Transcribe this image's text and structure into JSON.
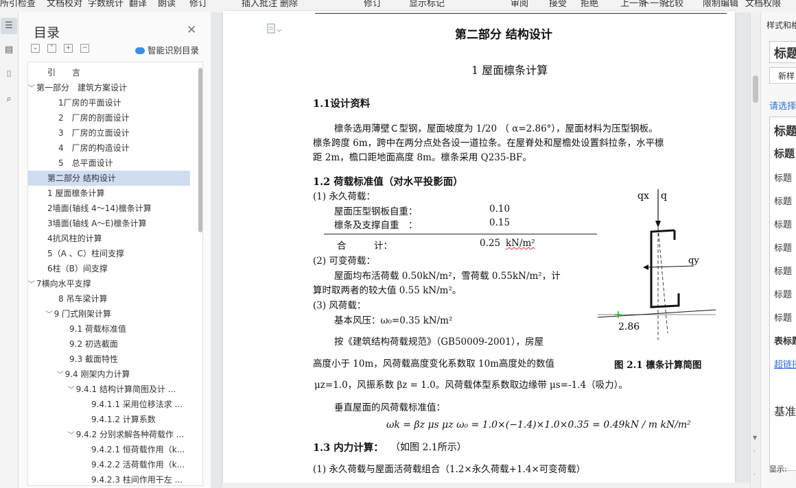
{
  "toolbar": {
    "items": [
      "所引检查",
      "文档校对",
      "字数统计",
      "翻译",
      "朗读",
      "修订",
      "插入批注",
      "删除",
      "修订",
      "显示标记",
      "审阅",
      "接受",
      "拒绝",
      "上一条",
      "下一条",
      "比较",
      "限制编辑",
      "文档权限"
    ]
  },
  "rail": {
    "icons": [
      "toc-icon",
      "outline-icon",
      "bookmark-icon",
      "search-icon"
    ]
  },
  "toc": {
    "title": "目录",
    "smart_label": "智能识别目录",
    "items": [
      {
        "label": "引　　言",
        "level": 1,
        "caret": ""
      },
      {
        "label": "第一部分　建筑方案设计",
        "level": 0,
        "caret": "﹀"
      },
      {
        "label": "1厂房的平面设计",
        "level": 2,
        "caret": ""
      },
      {
        "label": "2　厂房的剖面设计",
        "level": 2,
        "caret": ""
      },
      {
        "label": "3　厂房的立面设计",
        "level": 2,
        "caret": ""
      },
      {
        "label": "4　厂房的构造设计",
        "level": 2,
        "caret": ""
      },
      {
        "label": "5　总平面设计",
        "level": 2,
        "caret": ""
      },
      {
        "label": "第二部分  结构设计",
        "level": 1,
        "caret": "",
        "selected": true
      },
      {
        "label": "1  屋面檩条计算",
        "level": 1,
        "caret": ""
      },
      {
        "label": "2墙面(轴线 4～14)檩条计算",
        "level": 1,
        "caret": ""
      },
      {
        "label": "3墙面(轴线 A～E)檩条计算",
        "level": 1,
        "caret": ""
      },
      {
        "label": "4抗风柱的计算",
        "level": 1,
        "caret": ""
      },
      {
        "label": "5（A 、C）柱间支撑",
        "level": 1,
        "caret": ""
      },
      {
        "label": "6柱（B）间支撑",
        "level": 1,
        "caret": ""
      },
      {
        "label": "7横向水平支撑",
        "level": 0,
        "caret": "﹀"
      },
      {
        "label": "8  吊车梁计算",
        "level": 2,
        "caret": ""
      },
      {
        "label": "9  门式刚架计算",
        "level": 1.6,
        "caret": "﹀"
      },
      {
        "label": "9.1  荷载标准值",
        "level": 3,
        "caret": ""
      },
      {
        "label": "9.2  初选截面",
        "level": 3,
        "caret": ""
      },
      {
        "label": "9.3  截面特性",
        "level": 3,
        "caret": ""
      },
      {
        "label": "9.4  刚架内力计算",
        "level": 2.6,
        "caret": "﹀"
      },
      {
        "label": "9.4.1  结构计算简图及计 ...",
        "level": 3.6,
        "caret": "﹀"
      },
      {
        "label": "9.4.1.1  采用位移法求 ...",
        "level": 5,
        "caret": ""
      },
      {
        "label": "9.4.1.2  计算系数",
        "level": 5,
        "caret": ""
      },
      {
        "label": "9.4.2 分别求解各种荷载作 ...",
        "level": 3.6,
        "caret": "﹀"
      },
      {
        "label": "9.4.2.1  恒荷载作用（k...",
        "level": 5,
        "caret": ""
      },
      {
        "label": "9.4.2.2  活荷载作用（k...",
        "level": 5,
        "caret": ""
      },
      {
        "label": "9.4.2.3  柱间作用干左 ...",
        "level": 5,
        "caret": ""
      }
    ]
  },
  "doc": {
    "part_title": "第二部分  结构设计",
    "section_title": "1  屋面檩条计算",
    "s11": "1.1设计资料",
    "p1_line1": "檩条选用薄壁Ｃ型钢，屋面坡度为 1/20  （ α=2.86°），屋面材料为压型钢板。",
    "p1_line2": "檩条跨度 6m，跨中在两分点处各设一道拉条。在屋脊处和屋檐处设置斜拉条，水平檩",
    "p1_line3": "距 2m，檐口距地面高度 8m。檩条采用 Q235-BF。",
    "s12": "1.2 荷载标准值（对水平投影面）",
    "perm": "(1) 永久荷载：",
    "perm_a_label": "屋面压型钢板自重：",
    "perm_a_val": "0.10",
    "perm_b_label": "檩条及支撑自重　：",
    "perm_b_val": "0.15",
    "sum_label": "合　　　计：",
    "sum_val": "0.25",
    "sum_unit": "kN/m²",
    "var": "(2) 可变荷载：",
    "var_line1": "屋面均布活荷载 0.50kN/m²，雪荷载 0.55kN/m²，计",
    "var_line2": "算时取两者的较大值 0.55 kN/m²。",
    "wind": "(3) 风荷载：",
    "wind_base": "基本风压：ω₀=0.35 kN/m²",
    "wind_p1": "按《建筑结构荷载规范》（GB50009-2001），房屋",
    "wind_p2": "高度小于 10m，风荷载高度变化系数取 10m高度处的数值",
    "wind_p3": "μz=1.0，风振系数 βz = 1.0。风荷载体型系数取边缘带 μs=-1.4（吸力）。",
    "wind_p4": "垂直屋面的风荷载标准值：",
    "formula": "ωk = βz μs μz ω₀ = 1.0×(−1.4)×1.0×0.35 = 0.49kN / m kN/m²",
    "s13": "1.3  内力计算：",
    "s13_note": "（如图 2.1所示）",
    "combo1": "(1) 永久荷载与屋面活荷载组合（1.2×永久荷载+1.4×可变荷载）",
    "fig_caption": "图 2.1   檩条计算简图",
    "fig_labels": {
      "qx": "qx",
      "q": "q",
      "qy": "qy",
      "angle": "2.86"
    }
  },
  "styles_panel": {
    "header": "样式和格",
    "heading1": "标题",
    "new_style": "新样",
    "choose": "请选择",
    "items": [
      "标题",
      "标题",
      "标题",
      "标题",
      "标题",
      "标题",
      "标题",
      "标题",
      "标题",
      "表标题",
      "超链接",
      "基准"
    ],
    "show_label": "显示:"
  }
}
